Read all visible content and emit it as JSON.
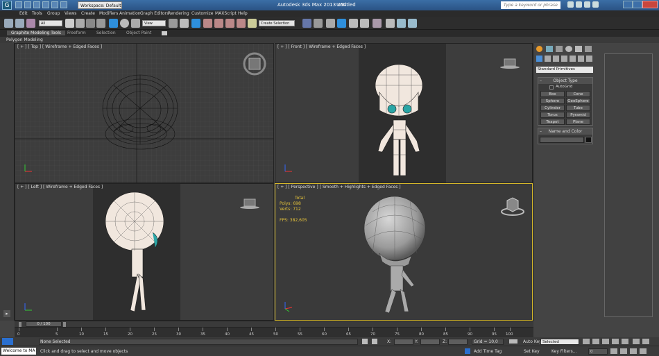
{
  "title_bar": {
    "app_title": "Autodesk 3ds Max  2013 x64",
    "doc_name": "Untitled",
    "workspace": "Workspace: Default",
    "search_placeholder": "Type a keyword or phrase"
  },
  "menu": [
    "Edit",
    "Tools",
    "Group",
    "Views",
    "Create",
    "Modifiers",
    "Animation",
    "Graph Editors",
    "Rendering",
    "Customize",
    "MAXScript",
    "Help"
  ],
  "toolbar": {
    "filter_value": "All",
    "refcoord_value": "View",
    "selection_set_value": "Create Selection Se"
  },
  "ribbon": {
    "tabs": [
      "Graphite Modeling Tools",
      "Freeform",
      "Selection",
      "Object Paint"
    ],
    "panel_label": "Polygon Modeling"
  },
  "viewports": {
    "top": "[ + ] [ Top ] [ Wireframe + Edged Faces ]",
    "front": "[ + ] [ Front ] [ Wireframe + Edged Faces ]",
    "left": "[ + ] [ Left ] [ Wireframe + Edged Faces ]",
    "perspective": "[ + ] [ Perspective ] [ Smooth + Highlights + Edged Faces ]"
  },
  "stats": {
    "total_label": "Total",
    "polys": "Polys:  698",
    "verts": "Verts:  712",
    "fps": "FPS:    382,605"
  },
  "command_panel": {
    "category": "Standard Primitives",
    "object_type_title": "Object Type",
    "autogrid_label": "AutoGrid",
    "buttons": [
      "Box",
      "Cone",
      "Sphere",
      "GeoSphere",
      "Cylinder",
      "Tube",
      "Torus",
      "Pyramid",
      "Teapot",
      "Plane"
    ],
    "name_color_title": "Name and Color"
  },
  "timeline": {
    "frame_counter": "0 / 100",
    "ticks": [
      "0",
      "5",
      "10",
      "15",
      "20",
      "25",
      "30",
      "35",
      "40",
      "45",
      "50",
      "55",
      "60",
      "65",
      "70",
      "75",
      "80",
      "85",
      "90",
      "95",
      "100"
    ]
  },
  "status": {
    "welcome": "Welcome to MA",
    "selection": "None Selected",
    "prompt": "Click and drag to select and move objects",
    "x_label": "X:",
    "y_label": "Y:",
    "z_label": "Z:",
    "grid": "Grid = 10,0",
    "add_time_tag": "Add Time Tag",
    "auto_key": "Auto Key",
    "set_key": "Set Key",
    "selected_value": "Selected",
    "key_filters": "Key Filters...",
    "frame_value": "0"
  },
  "colors": {
    "titlebar": "#3b6ea5",
    "viewport_bg": "#3d3d3d",
    "active_border": "#d7b92b",
    "stats_yellow": "#e7c43a"
  }
}
